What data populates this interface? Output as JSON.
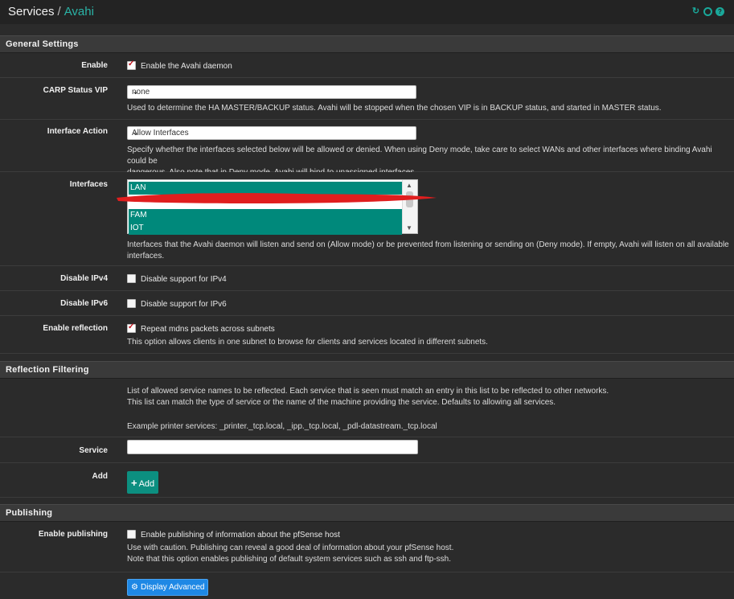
{
  "breadcrumb": {
    "section": "Services",
    "separator": "/",
    "page": "Avahi"
  },
  "header_icons": [
    "reload-icon",
    "settings-circle-icon",
    "help-icon"
  ],
  "colors": {
    "accent": "#2ab3a6",
    "selection": "#00897b",
    "add_button": "#0c8f80",
    "advanced_button": "#1e88e5"
  },
  "general": {
    "title": "General Settings",
    "enable": {
      "label": "Enable",
      "checkbox_label": "Enable the Avahi daemon",
      "checked": true
    },
    "carp": {
      "label": "CARP Status VIP",
      "value": "none",
      "help": "Used to determine the HA MASTER/BACKUP status. Avahi will be stopped when the chosen VIP is in BACKUP status, and started in MASTER status."
    },
    "interface_action": {
      "label": "Interface Action",
      "value": "Allow Interfaces",
      "help1": "Specify whether the interfaces selected below will be allowed or denied. When using Deny mode, take care to select WANs and other interfaces where binding Avahi could be",
      "help2": "dangerous. Also note that in Deny mode, Avahi will bind to unassigned interfaces."
    },
    "interfaces": {
      "label": "Interfaces",
      "options": [
        "LAN",
        "FAM",
        "IOT"
      ],
      "help1": "Interfaces that the Avahi daemon will listen and send on (Allow mode) or be prevented from listening or sending on (Deny mode). If empty, Avahi will listen on all available",
      "help2": "interfaces."
    },
    "disable_ipv4": {
      "label": "Disable IPv4",
      "checkbox_label": "Disable support for IPv4",
      "checked": false
    },
    "disable_ipv6": {
      "label": "Disable IPv6",
      "checkbox_label": "Disable support for IPv6",
      "checked": false
    },
    "reflection": {
      "label": "Enable reflection",
      "checkbox_label": "Repeat mdns packets across subnets",
      "checked": true,
      "help": "This option allows clients in one subnet to browse for clients and services located in different subnets."
    }
  },
  "reflection_filtering": {
    "title": "Reflection Filtering",
    "desc1": "List of allowed service names to be reflected. Each service that is seen must match an entry in this list to be reflected to other networks.",
    "desc2": "This list can match the type of service or the name of the machine providing the service. Defaults to allowing all services.",
    "example": "Example printer services: _printer._tcp.local, _ipp._tcp.local, _pdl-datastream._tcp.local",
    "service_label": "Service",
    "service_value": "",
    "add_label": "Add",
    "add_button": "Add"
  },
  "publishing": {
    "title": "Publishing",
    "enable": {
      "label": "Enable publishing",
      "checkbox_label": "Enable publishing of information about the pfSense host",
      "checked": false
    },
    "help1": "Use with caution. Publishing can reveal a good deal of information about your pfSense host.",
    "help2": "Note that this option enables publishing of default system services such as ssh and ftp-ssh.",
    "advanced_button": "Display Advanced"
  }
}
